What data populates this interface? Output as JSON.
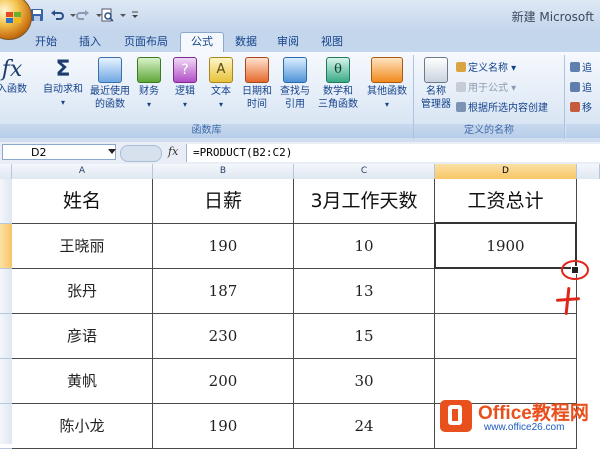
{
  "window": {
    "title": "新建 Microsoft"
  },
  "tabs": [
    "开始",
    "插入",
    "页面布局",
    "公式",
    "数据",
    "审阅",
    "视图"
  ],
  "active_tab": "公式",
  "ribbon": {
    "function_library": {
      "label": "函数库",
      "insert_function": "入函数",
      "autosum": "自动求和",
      "recent_line1": "最近使用",
      "recent_line2": "的函数",
      "financial": "财务",
      "logical": "逻辑",
      "text": "文本",
      "datetime_line1": "日期和",
      "datetime_line2": "时间",
      "lookup_line1": "查找与",
      "lookup_line2": "引用",
      "math_line1": "数学和",
      "math_line2": "三角函数",
      "more": "其他函数"
    },
    "defined_names": {
      "label": "定义的名称",
      "name_manager_line1": "名称",
      "name_manager_line2": "管理器",
      "define_name": "定义名称",
      "use_in_formula": "用于公式",
      "create_from_selection": "根据所选内容创建"
    },
    "auditing": {
      "trace1": "追",
      "trace2": "追",
      "remove": "移"
    }
  },
  "formula_bar": {
    "name_box": "D2",
    "fx": "fx",
    "formula": "=PRODUCT(B2:C2)"
  },
  "columns": [
    "A",
    "B",
    "C",
    "D"
  ],
  "selected_cell": "D2",
  "table": {
    "headers": [
      "姓名",
      "日薪",
      "3月工作天数",
      "工资总计"
    ],
    "rows": [
      [
        "王晓丽",
        "190",
        "10",
        "1900"
      ],
      [
        "张丹",
        "187",
        "13",
        ""
      ],
      [
        "彦语",
        "230",
        "15",
        ""
      ],
      [
        "黄帆",
        "200",
        "30",
        ""
      ],
      [
        "陈小龙",
        "190",
        "24",
        ""
      ]
    ]
  },
  "watermark": {
    "name": "Office教程网",
    "url": "www.office26.com"
  },
  "colors": {
    "ribbon_bg": "#dde8f5",
    "active_header": "#f7c566",
    "annotation": "#e0261b",
    "brand": "#e8501d"
  }
}
